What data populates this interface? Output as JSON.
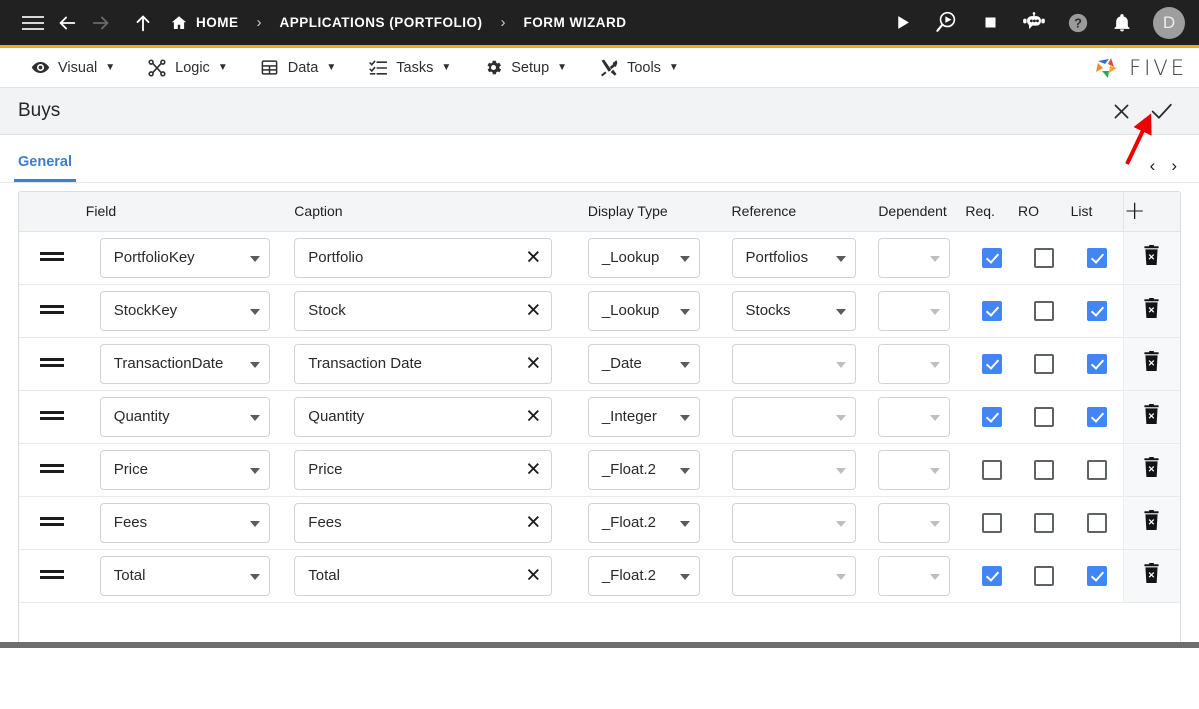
{
  "topbar": {
    "menu_icon": "hamburger-icon",
    "back_icon": "arrow-left-icon",
    "forward_icon": "arrow-right-icon",
    "up_icon": "arrow-up-icon",
    "breadcrumbs": [
      {
        "label": "HOME",
        "icon": "home-icon"
      },
      {
        "label": "APPLICATIONS (PORTFOLIO)",
        "icon": ""
      },
      {
        "label": "FORM WIZARD",
        "icon": ""
      }
    ],
    "separator": "›",
    "actions": [
      {
        "name": "run-icon"
      },
      {
        "name": "search-run-icon"
      },
      {
        "name": "stop-icon"
      },
      {
        "name": "chat-bot-icon"
      },
      {
        "name": "help-icon"
      },
      {
        "name": "notifications-bell-icon"
      }
    ],
    "avatar_initial": "D"
  },
  "menubar": {
    "items": [
      {
        "label": "Visual",
        "icon": "eye-icon",
        "caret": "▼"
      },
      {
        "label": "Logic",
        "icon": "logic-nodes-icon",
        "caret": "▼"
      },
      {
        "label": "Data",
        "icon": "table-icon",
        "caret": "▼"
      },
      {
        "label": "Tasks",
        "icon": "checklist-icon",
        "caret": "▼"
      },
      {
        "label": "Setup",
        "icon": "gear-icon",
        "caret": "▼"
      },
      {
        "label": "Tools",
        "icon": "wrench-screwdriver-icon",
        "caret": "▼"
      }
    ],
    "brand": "FIVE"
  },
  "titlebar": {
    "title": "Buys",
    "cancel_icon": "close-x-icon",
    "confirm_icon": "check-icon"
  },
  "tabs": {
    "items": [
      {
        "label": "General",
        "active": true
      }
    ],
    "prev_icon": "‹",
    "next_icon": "›"
  },
  "grid": {
    "headers": {
      "handle": "",
      "field": "Field",
      "caption": "Caption",
      "display_type": "Display Type",
      "reference": "Reference",
      "dependent": "Dependent",
      "req": "Req.",
      "ro": "RO",
      "list": "List",
      "add": "+"
    },
    "rows": [
      {
        "field": "PortfolioKey",
        "caption": "Portfolio",
        "display_type": "_Lookup",
        "reference": "Portfolios",
        "reference_enabled": true,
        "dependent": "",
        "req": true,
        "ro": false,
        "list": true
      },
      {
        "field": "StockKey",
        "caption": "Stock",
        "display_type": "_Lookup",
        "reference": "Stocks",
        "reference_enabled": true,
        "dependent": "",
        "req": true,
        "ro": false,
        "list": true
      },
      {
        "field": "TransactionDate",
        "caption": "Transaction Date",
        "display_type": "_Date",
        "reference": "",
        "reference_enabled": false,
        "dependent": "",
        "req": true,
        "ro": false,
        "list": true
      },
      {
        "field": "Quantity",
        "caption": "Quantity",
        "display_type": "_Integer",
        "reference": "",
        "reference_enabled": false,
        "dependent": "",
        "req": true,
        "ro": false,
        "list": true
      },
      {
        "field": "Price",
        "caption": "Price",
        "display_type": "_Float.2",
        "reference": "",
        "reference_enabled": false,
        "dependent": "",
        "req": false,
        "ro": false,
        "list": false
      },
      {
        "field": "Fees",
        "caption": "Fees",
        "display_type": "_Float.2",
        "reference": "",
        "reference_enabled": false,
        "dependent": "",
        "req": false,
        "ro": false,
        "list": false
      },
      {
        "field": "Total",
        "caption": "Total",
        "display_type": "_Float.2",
        "reference": "",
        "reference_enabled": false,
        "dependent": "",
        "req": true,
        "ro": false,
        "list": true
      }
    ],
    "row_clear_icon": "close-x-icon",
    "row_delete_icon": "trash-delete-icon",
    "drag_handle_icon": "drag-handle-icon"
  },
  "annotation": {
    "type": "arrow",
    "color": "#ee0000",
    "points_to": "confirm-check-button"
  },
  "colors": {
    "accent_blue": "#3c7fd0",
    "checkbox_blue": "#4285f4",
    "topbar_bg": "#212121",
    "topbar_underline": "#f5a623",
    "titlebar_bg": "#f2f3f5",
    "header_bg": "#f4f5f7"
  }
}
